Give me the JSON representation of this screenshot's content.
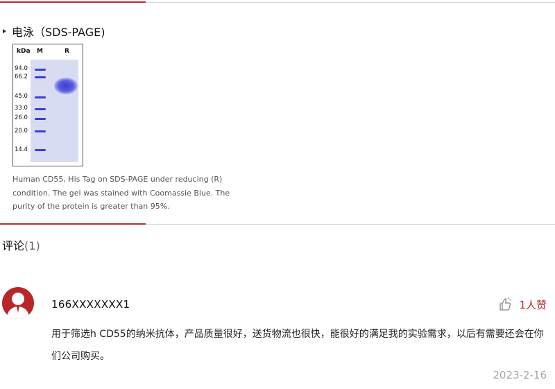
{
  "section": {
    "title": "电泳（SDS-PAGE)"
  },
  "gel": {
    "lane_headers": [
      "kDa",
      "M",
      "R"
    ],
    "markers_kda": [
      "94.0",
      "66.2",
      "45.0",
      "33.0",
      "26.0",
      "20.0",
      "14.4"
    ]
  },
  "caption": "Human CD55, His Tag on SDS-PAGE under reducing (R) condition. The gel was stained with Coomassie Blue. The purity of the protein is greater than 95%.",
  "comments": {
    "label": "评论",
    "count": "(1)",
    "items": [
      {
        "user": "166XXXXXXX1",
        "likes": "1人赞",
        "text": "用于筛选h CD55的纳米抗体，产品质量很好，送货物流也很快，能很好的满足我的实验需求，以后有需要还会在你们公司购买。",
        "date": "2023-2-16",
        "avatar_icon": "user-avatar-icon",
        "like_icon": "thumbs-up-icon"
      }
    ]
  },
  "colors": {
    "accent": "#c4292a",
    "avatar": "#b8262a",
    "gel_band": "#3a3fd0"
  }
}
